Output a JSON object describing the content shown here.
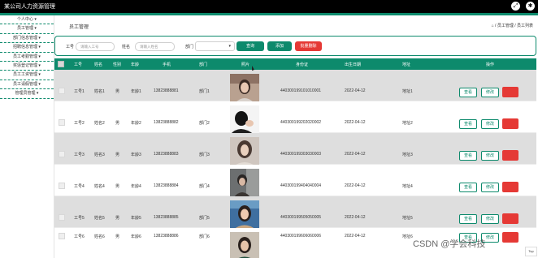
{
  "app": {
    "title": "某公司人力资源管理",
    "topbar_icons": [
      "fullscreen-icon",
      "user-avatar-icon"
    ]
  },
  "sidebar": {
    "items": [
      {
        "label": "个人中心"
      },
      {
        "label": "员工管理"
      },
      {
        "label": "部门信息管理"
      },
      {
        "label": "招聘信息管理"
      },
      {
        "label": "员工考勤管理"
      },
      {
        "label": "奖惩登记管理"
      },
      {
        "label": "员工工资管理"
      },
      {
        "label": "员工请假管理"
      },
      {
        "label": "管理员管理"
      }
    ]
  },
  "page": {
    "title": "员工管理",
    "breadcrumb": "⌂ / 员工管理 / 员工列表",
    "home_icon": "home-icon"
  },
  "filters": {
    "employee_no": {
      "label": "工号",
      "placeholder": "请输入工号"
    },
    "name": {
      "label": "姓名",
      "placeholder": "请输入姓名"
    },
    "department": {
      "label": "部门",
      "value": ""
    },
    "query_label": "查询",
    "add_label": "添加",
    "batch_delete_label": "批量删除"
  },
  "table": {
    "columns": [
      "工号",
      "姓名",
      "性别",
      "年龄",
      "手机",
      "部门",
      "照片",
      "身份证",
      "出生日期",
      "地址",
      "操作"
    ],
    "action_labels": {
      "view": "查看",
      "edit": "修改",
      "delete": "删除"
    },
    "rows": [
      {
        "no": "工号1",
        "name": "姓名1",
        "gender": "男",
        "age": "年龄1",
        "phone": "13823888881",
        "dept": "部门1",
        "idcard": "440300199101010001",
        "birth": "2022-04-12",
        "address": "地址1"
      },
      {
        "no": "工号2",
        "name": "姓名2",
        "gender": "男",
        "age": "年龄2",
        "phone": "13823888882",
        "dept": "部门2",
        "idcard": "440300199202020002",
        "birth": "2022-04-12",
        "address": "地址2"
      },
      {
        "no": "工号3",
        "name": "姓名3",
        "gender": "男",
        "age": "年龄3",
        "phone": "13823888883",
        "dept": "部门3",
        "idcard": "440300199303030003",
        "birth": "2022-04-12",
        "address": "地址3"
      },
      {
        "no": "工号4",
        "name": "姓名4",
        "gender": "男",
        "age": "年龄4",
        "phone": "13823888884",
        "dept": "部门4",
        "idcard": "440300199404040004",
        "birth": "2022-04-12",
        "address": "地址4"
      },
      {
        "no": "工号5",
        "name": "姓名5",
        "gender": "男",
        "age": "年龄5",
        "phone": "13823888885",
        "dept": "部门5",
        "idcard": "440300199505050005",
        "birth": "2022-04-12",
        "address": "地址5"
      },
      {
        "no": "工号6",
        "name": "姓名6",
        "gender": "男",
        "age": "年龄6",
        "phone": "13823888886",
        "dept": "部门6",
        "idcard": "440300199606060006",
        "birth": "2022-04-12",
        "address": "地址6"
      }
    ]
  },
  "watermark": "CSDN @学会科技",
  "back_to_top": "Top",
  "colors": {
    "accent": "#0d8a6c",
    "danger": "#e53935"
  }
}
